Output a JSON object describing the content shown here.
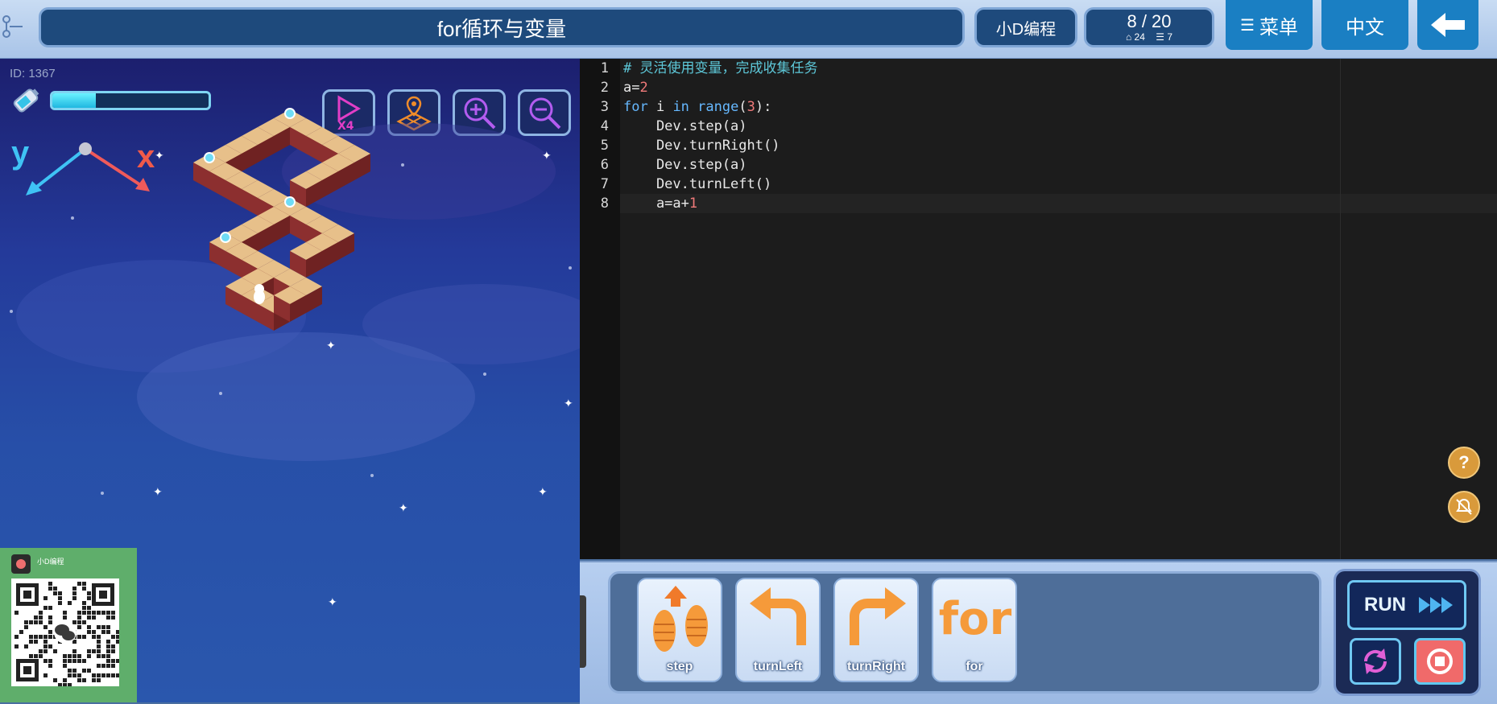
{
  "header": {
    "title": "for循环与变量",
    "brand_label": "小D编程",
    "level": "8 / 20",
    "stat_coins": "24",
    "stat_lines": "7",
    "menu_label": "菜单",
    "lang_label": "中文"
  },
  "game": {
    "id_label": "ID: 1367",
    "energy_level": 0.28,
    "axis_y_label": "y",
    "axis_x_label": "x",
    "tools": [
      "speed-x4-icon",
      "map-icon",
      "zoom-in-icon",
      "zoom-out-icon"
    ],
    "qr_caption": "小D编程"
  },
  "editor": {
    "lines": [
      {
        "n": "1",
        "text": "# 灵活使用变量，完成收集任务"
      },
      {
        "n": "2",
        "text": "a=2"
      },
      {
        "n": "3",
        "text": "for i in range(3):"
      },
      {
        "n": "4",
        "text": "    Dev.step(a)"
      },
      {
        "n": "5",
        "text": "    Dev.turnRight()"
      },
      {
        "n": "6",
        "text": "    Dev.step(a)"
      },
      {
        "n": "7",
        "text": "    Dev.turnLeft()"
      },
      {
        "n": "8",
        "text": "    a=a+1"
      }
    ]
  },
  "commands": [
    {
      "label": "step",
      "icon": "footsteps-icon"
    },
    {
      "label": "turnLeft",
      "icon": "turn-left-arrow-icon"
    },
    {
      "label": "turnRight",
      "icon": "turn-right-arrow-icon"
    },
    {
      "label": "for",
      "icon": "for-text-icon",
      "icon_text": "for"
    }
  ],
  "controls": {
    "run_label": "RUN",
    "help_icon": "?"
  }
}
